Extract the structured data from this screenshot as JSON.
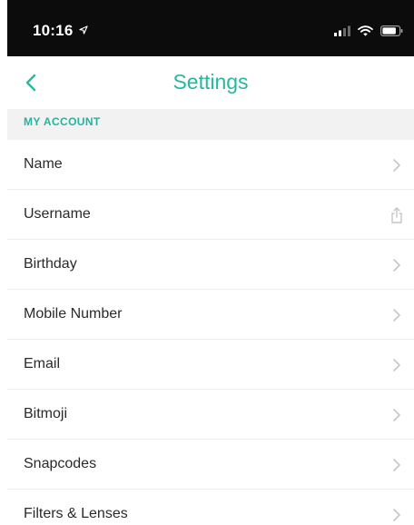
{
  "status_bar": {
    "time": "10:16"
  },
  "nav": {
    "title": "Settings",
    "back_icon": "chevron-left-icon"
  },
  "section": {
    "title": "MY ACCOUNT"
  },
  "colors": {
    "accent": "#28b7a0",
    "section_bg": "#f2f2f2",
    "status_bg": "#0c0c0c"
  },
  "rows": [
    {
      "label": "Name",
      "icon": "chevron-right-icon"
    },
    {
      "label": "Username",
      "icon": "share-icon"
    },
    {
      "label": "Birthday",
      "icon": "chevron-right-icon"
    },
    {
      "label": "Mobile Number",
      "icon": "chevron-right-icon"
    },
    {
      "label": "Email",
      "icon": "chevron-right-icon"
    },
    {
      "label": "Bitmoji",
      "icon": "chevron-right-icon"
    },
    {
      "label": "Snapcodes",
      "icon": "chevron-right-icon"
    },
    {
      "label": "Filters & Lenses",
      "icon": "chevron-right-icon"
    }
  ]
}
